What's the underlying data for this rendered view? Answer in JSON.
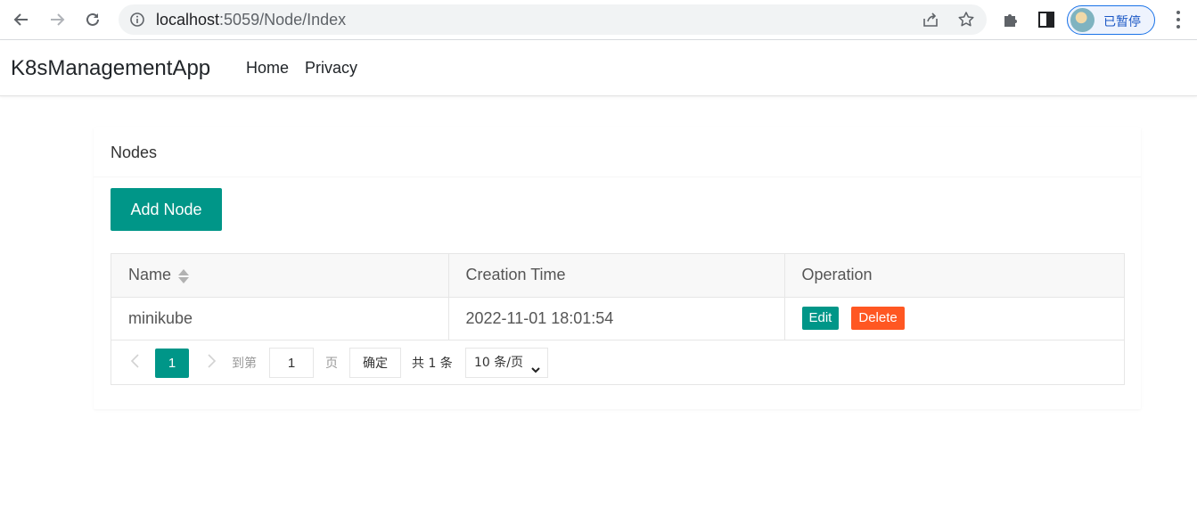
{
  "browser": {
    "url_host": "localhost",
    "url_rest": ":5059/Node/Index",
    "profile_label": "已暂停"
  },
  "navbar": {
    "brand": "K8sManagementApp",
    "links": [
      "Home",
      "Privacy"
    ]
  },
  "card": {
    "title": "Nodes",
    "add_button": "Add Node"
  },
  "table": {
    "columns": [
      "Name",
      "Creation Time",
      "Operation"
    ],
    "rows": [
      {
        "name": "minikube",
        "creation_time": "2022-11-01 18:01:54"
      }
    ],
    "edit_label": "Edit",
    "delete_label": "Delete"
  },
  "pager": {
    "current_page": "1",
    "goto_prefix": "到第",
    "goto_value": "1",
    "goto_suffix": "页",
    "confirm_label": "确定",
    "total_text": "共 1 条",
    "page_size": "10 条/页"
  },
  "colors": {
    "primary": "#009688",
    "danger": "#ff5722"
  }
}
